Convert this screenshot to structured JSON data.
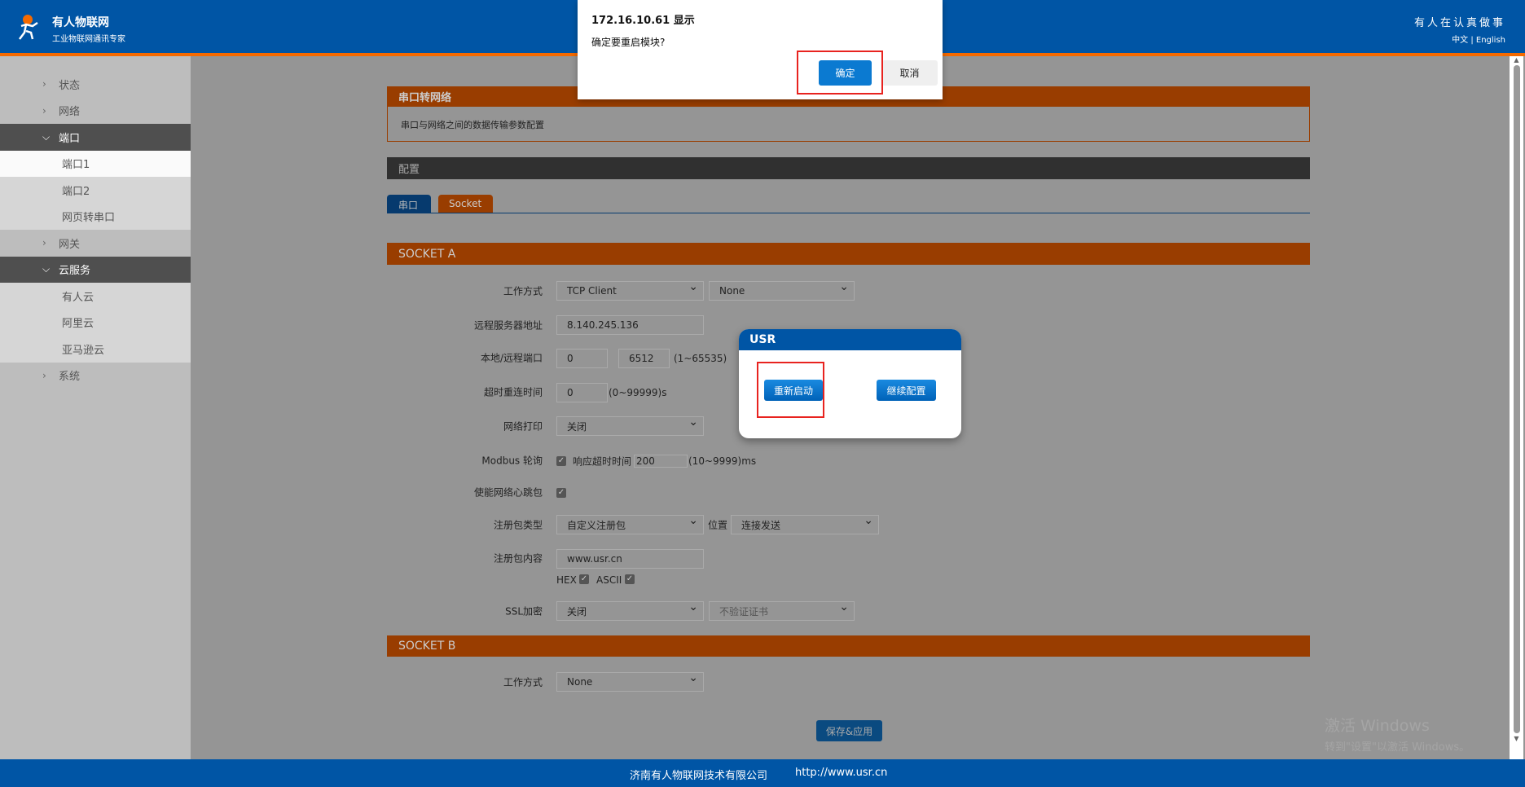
{
  "header": {
    "brand": "有人物联网",
    "tagline": "工业物联网通讯专家",
    "slogan": "有人在认真做事",
    "lang_zh": "中文",
    "lang_sep": "|",
    "lang_en": "English"
  },
  "sidebar": {
    "items": [
      {
        "label": "状态",
        "type": "collapsed"
      },
      {
        "label": "网络",
        "type": "collapsed"
      },
      {
        "label": "端口",
        "type": "expanded"
      },
      {
        "label": "端口1",
        "type": "sub-active"
      },
      {
        "label": "端口2",
        "type": "sub"
      },
      {
        "label": "网页转串口",
        "type": "sub"
      },
      {
        "label": "网关",
        "type": "collapsed"
      },
      {
        "label": "云服务",
        "type": "expanded"
      },
      {
        "label": "有人云",
        "type": "sub"
      },
      {
        "label": "阿里云",
        "type": "sub"
      },
      {
        "label": "亚马逊云",
        "type": "sub"
      },
      {
        "label": "系统",
        "type": "collapsed"
      }
    ]
  },
  "panel": {
    "title": "串口转网络",
    "description": "串口与网络之间的数据传输参数配置"
  },
  "config_title": "配置",
  "tabs": [
    {
      "label": "串口"
    },
    {
      "label": "Socket"
    }
  ],
  "socket_a": {
    "title": "SOCKET A",
    "work_mode_label": "工作方式",
    "work_mode": "TCP Client",
    "work_mode_2": "None",
    "server_label": "远程服务器地址",
    "server": "8.140.245.136",
    "port_label": "本地/远程端口",
    "local_port": "0",
    "remote_port": "6512",
    "port_range": "(1~65535)",
    "reconnect_label": "超时重连时间",
    "reconnect": "0",
    "reconnect_range": "(0~99999)s",
    "netprint_label": "网络打印",
    "netprint": "关闭",
    "modbus_label": "Modbus 轮询",
    "modbus_timeout_label": "响应超时时间",
    "modbus_timeout": "200",
    "modbus_range": "(10~9999)ms",
    "heartbeat_label": "使能网络心跳包",
    "reg_type_label": "注册包类型",
    "reg_type": "自定义注册包",
    "position_label": "位置",
    "position": "连接发送",
    "reg_content_label": "注册包内容",
    "reg_content": "www.usr.cn",
    "hex_label": "HEX",
    "ascii_label": "ASCII",
    "ssl_label": "SSL加密",
    "ssl": "关闭",
    "ssl_cert": "不验证证书"
  },
  "socket_b": {
    "title": "SOCKET B",
    "work_mode_label": "工作方式",
    "work_mode": "None"
  },
  "save_button": "保存&应用",
  "footer": {
    "company": "济南有人物联网技术有限公司",
    "url": "http://www.usr.cn"
  },
  "watermark": {
    "line1": "激活 Windows",
    "line2": "转到\"设置\"以激活 Windows。"
  },
  "confirm_dialog": {
    "title": "172.16.10.61 显示",
    "message": "确定要重启模块?",
    "ok": "确定",
    "cancel": "取消"
  },
  "usr_dialog": {
    "title": "USR",
    "restart": "重新启动",
    "continue": "继续配置"
  }
}
